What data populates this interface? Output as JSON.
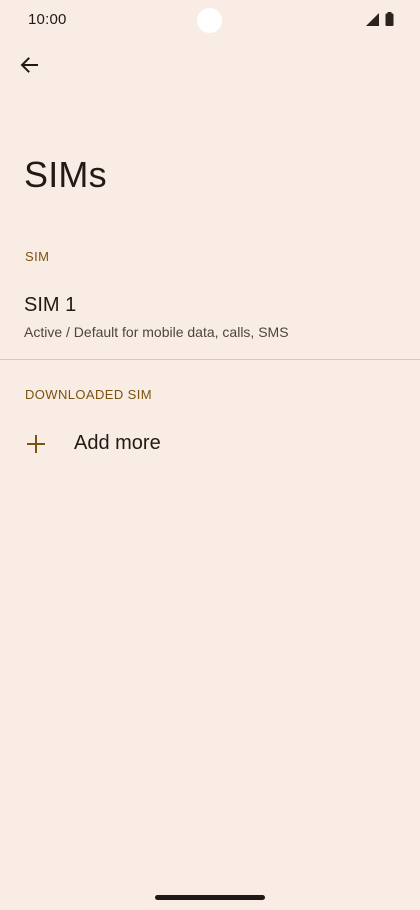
{
  "status_bar": {
    "time": "10:00",
    "icons": [
      "signal-icon",
      "battery-icon"
    ]
  },
  "app_bar": {
    "back_icon": "arrow-back-icon"
  },
  "page": {
    "title": "SIMs"
  },
  "sections": {
    "sim": {
      "header": "SIM",
      "items": [
        {
          "title": "SIM 1",
          "summary": "Active / Default for mobile data, calls, SMS"
        }
      ]
    },
    "downloaded_sim": {
      "header": "DOWNLOADED SIM",
      "add_more_label": "Add more",
      "add_icon": "plus-icon"
    }
  },
  "colors": {
    "background": "#f8ece4",
    "accent": "#7a5310",
    "text_primary": "#221a14",
    "text_secondary": "#4f4540"
  }
}
